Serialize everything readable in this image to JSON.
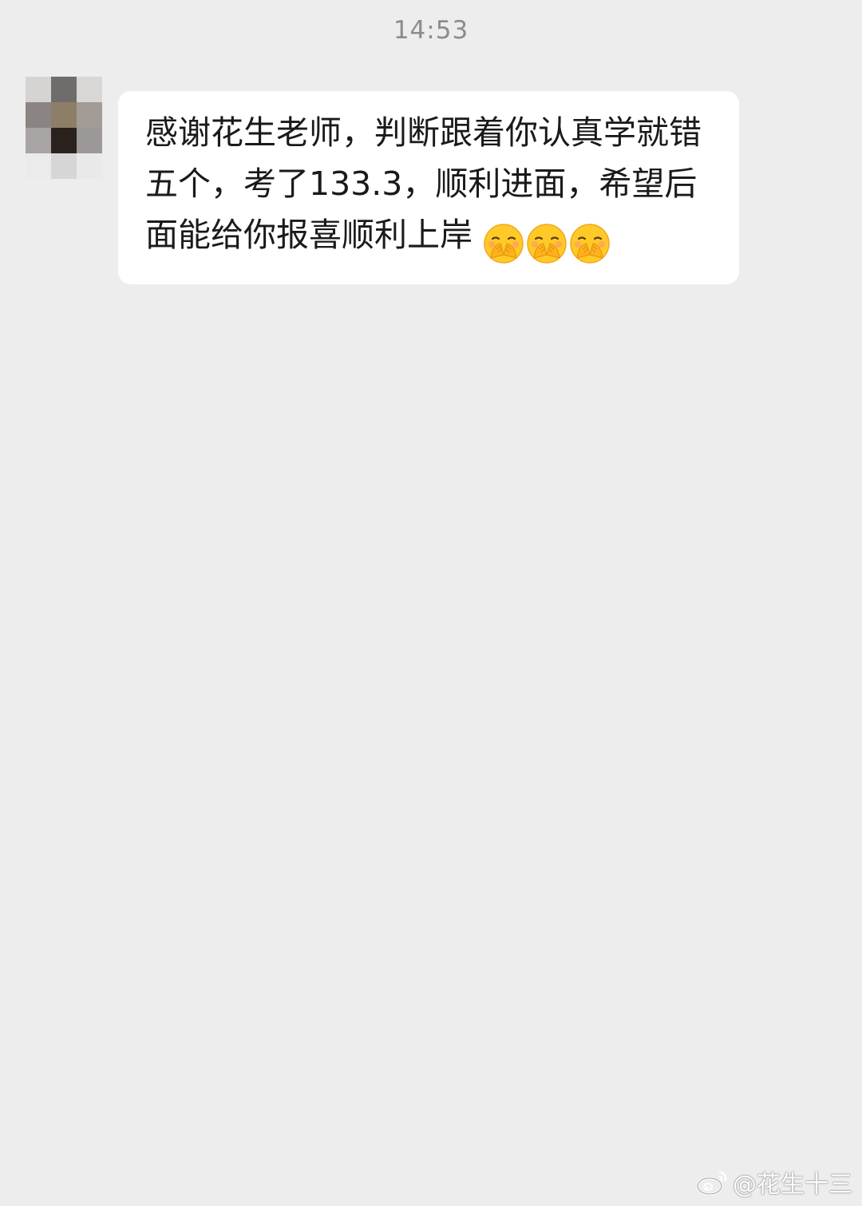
{
  "chat": {
    "timestamp": "14:53",
    "message": {
      "text": "感谢花生老师，判断跟着你认真学就错五个，考了133.3，顺利进面，希望后面能给你报喜顺利上岸",
      "emojis": [
        "face-with-hands-over-mouth-emoji",
        "face-with-hands-over-mouth-emoji",
        "face-with-hands-over-mouth-emoji"
      ]
    }
  },
  "watermark": {
    "handle": "@花生十三",
    "icon": "weibo-logo-icon"
  },
  "colors": {
    "background": "#ededed",
    "bubble": "#ffffff",
    "text": "#1a1a1a",
    "timestamp": "#8c8c8c",
    "emoji_face": "#ffc928"
  }
}
